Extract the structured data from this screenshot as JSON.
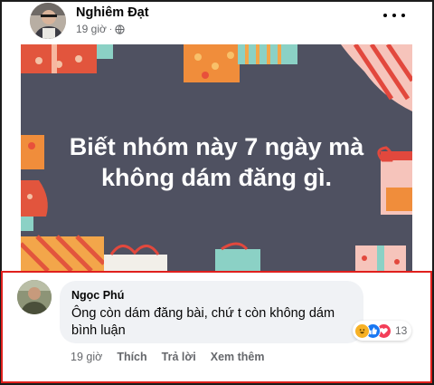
{
  "post": {
    "author": "Nghiêm Đạt",
    "time": "19 giờ",
    "separator": "·",
    "privacy_icon": "globe-icon",
    "image_text_line1": "Biết nhóm này 7 ngày mà",
    "image_text_line2": "không dám đăng gì.",
    "image_background": "#4f5161"
  },
  "comment": {
    "author": "Ngọc Phú",
    "text": "Ông còn dám đăng bài, chứ t còn không dám bình luận",
    "reactions": [
      "haha-icon",
      "like-icon",
      "love-icon"
    ],
    "reaction_count": "13",
    "time": "19 giờ",
    "like_label": "Thích",
    "reply_label": "Trả lời",
    "see_more_label": "Xem thêm"
  },
  "colors": {
    "highlight_border": "#e0201d",
    "bubble": "#f0f2f5",
    "meta_text": "#65676b"
  }
}
